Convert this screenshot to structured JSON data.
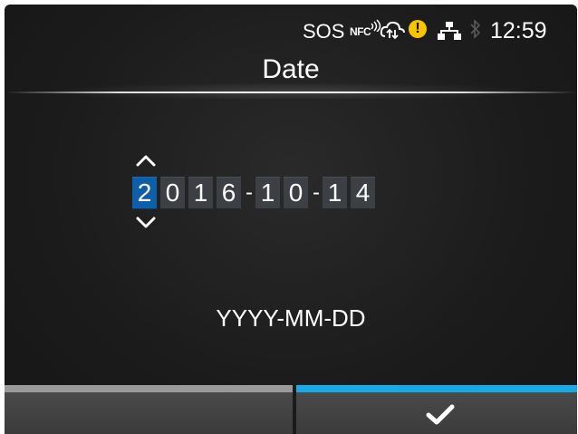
{
  "status_bar": {
    "sos_label": "SOS",
    "nfc_label": "NFC",
    "time": "12:59",
    "icons": [
      "nfc-waves-icon",
      "cloud-sync-icon",
      "warning-icon",
      "lan-icon",
      "bluetooth-icon"
    ],
    "warning_symbol": "!"
  },
  "title": "Date",
  "date_editor": {
    "digits": [
      "2",
      "0",
      "1",
      "6",
      "1",
      "0",
      "1",
      "4"
    ],
    "separator": "-",
    "active_digit_index": 0,
    "up_icon": "chevron-up-icon",
    "down_icon": "chevron-down-icon"
  },
  "format_hint": "YYYY-MM-DD",
  "function_keys": {
    "left": {
      "label": ""
    },
    "right": {
      "icon": "checkmark-icon"
    }
  },
  "colors": {
    "active_digit": "#0f5ea8",
    "confirm_accent": "#19a9e8",
    "left_accent": "#9a9a9a",
    "warning": "#f6c500"
  }
}
